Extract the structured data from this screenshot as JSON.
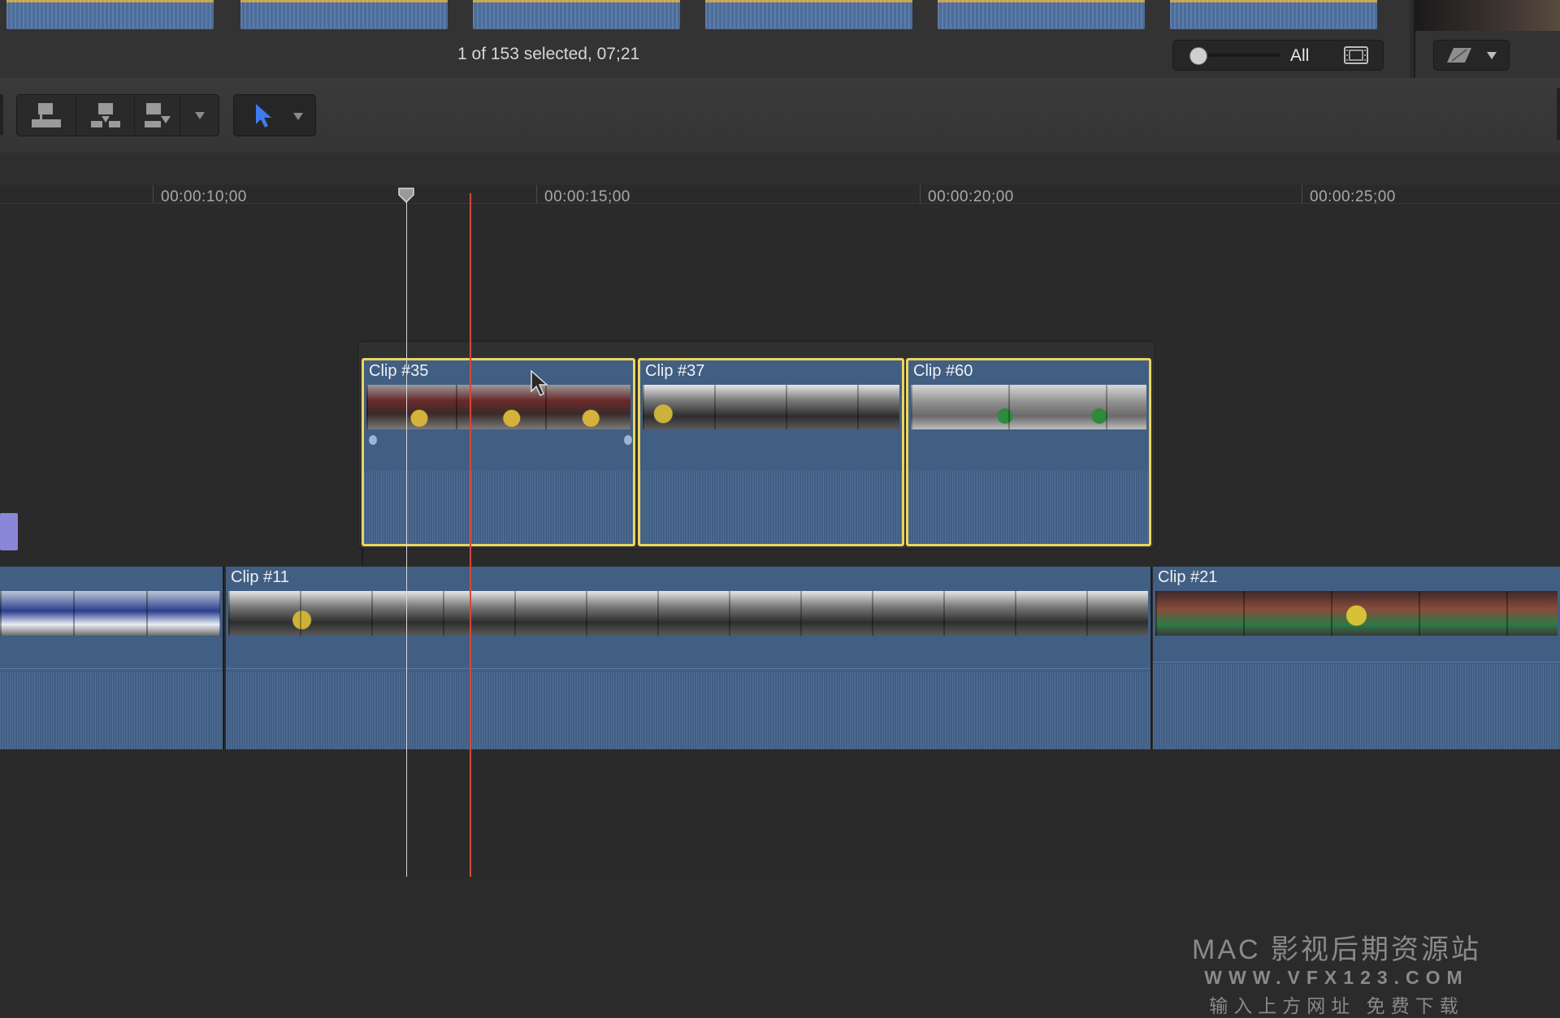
{
  "browser": {
    "selection_status": "1 of 153 selected, 07;21",
    "zoom_label": "All",
    "filmstrip_icon": "filmstrip-icon",
    "effects_icon": "effects-icon",
    "effects_menu_icon": "chevron-down-icon"
  },
  "toolbar": {
    "edit_buttons": [
      {
        "name": "connect-clip-button",
        "icon": "connect-clip-icon"
      },
      {
        "name": "insert-clip-button",
        "icon": "insert-clip-icon"
      },
      {
        "name": "append-clip-button",
        "icon": "append-clip-icon"
      }
    ],
    "edit_menu_icon": "chevron-down-icon",
    "tool_icon": "arrow-select-tool-icon",
    "tool_menu_icon": "chevron-down-icon"
  },
  "ruler": {
    "timecodes": [
      "00:00:10;00",
      "00:00:15;00",
      "00:00:20;00",
      "00:00:25;00"
    ]
  },
  "connected_clips": [
    {
      "name": "Clip #35",
      "selected": true
    },
    {
      "name": "Clip #37",
      "selected": true
    },
    {
      "name": "Clip #60",
      "selected": true
    }
  ],
  "primary_clips": [
    {
      "name": ""
    },
    {
      "name": "Clip #11"
    },
    {
      "name": "Clip #21"
    }
  ],
  "colors": {
    "selection_outline": "#e9d560",
    "clip_body": "#415e83",
    "skimmer": "#d6473b",
    "playhead": "#d8d8d8"
  },
  "watermark": {
    "line1": "MAC 影视后期资源站",
    "line2": "WWW.VFX123.COM",
    "line3": "输入上方网址 免费下载"
  }
}
